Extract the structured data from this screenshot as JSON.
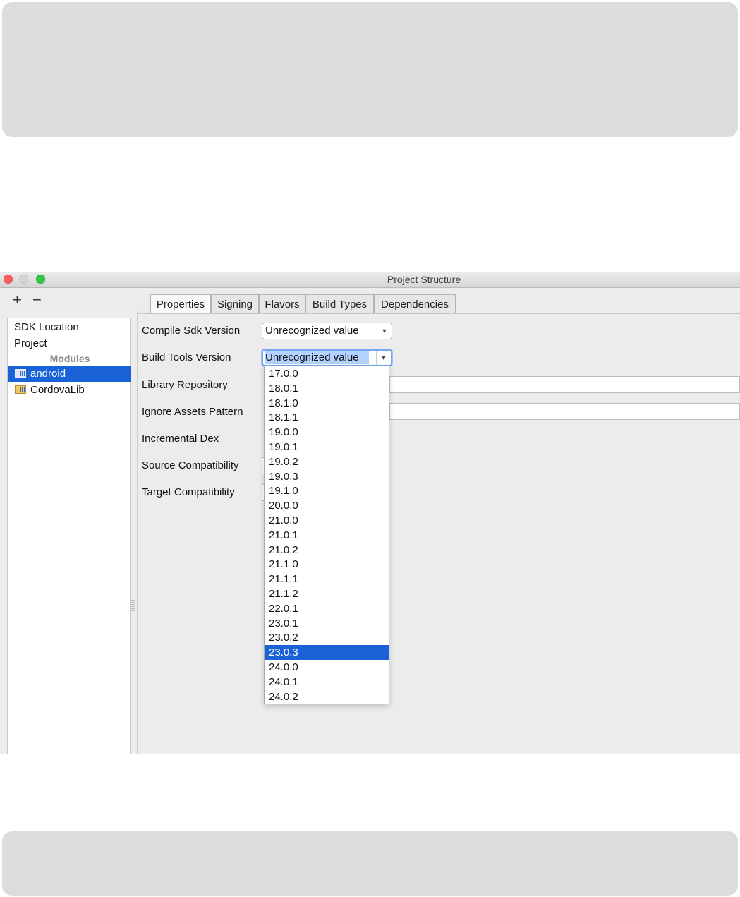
{
  "window": {
    "title": "Project Structure"
  },
  "toolbar": {
    "add_symbol": "+",
    "remove_symbol": "−"
  },
  "sidebar": {
    "sdk_location": "SDK Location",
    "project": "Project",
    "modules_header": "Modules",
    "modules": [
      {
        "label": "android",
        "selected": true
      },
      {
        "label": "CordovaLib",
        "selected": false
      }
    ]
  },
  "tabs": [
    {
      "label": "Properties",
      "active": true
    },
    {
      "label": "Signing"
    },
    {
      "label": "Flavors"
    },
    {
      "label": "Build Types"
    },
    {
      "label": "Dependencies"
    }
  ],
  "form": {
    "compile_sdk_label": "Compile Sdk Version",
    "compile_sdk_value": "Unrecognized value",
    "build_tools_label": "Build Tools Version",
    "build_tools_value": "Unrecognized value",
    "library_repo_label": "Library Repository",
    "ignore_assets_label": "Ignore Assets Pattern",
    "incremental_dex_label": "Incremental Dex",
    "source_compat_label": "Source Compatibility",
    "target_compat_label": "Target Compatibility"
  },
  "dropdown": {
    "selected": "23.0.3",
    "options": [
      "17.0.0",
      "18.0.1",
      "18.1.0",
      "18.1.1",
      "19.0.0",
      "19.0.1",
      "19.0.2",
      "19.0.3",
      "19.1.0",
      "20.0.0",
      "21.0.0",
      "21.0.1",
      "21.0.2",
      "21.1.0",
      "21.1.1",
      "21.1.2",
      "22.0.1",
      "23.0.1",
      "23.0.2",
      "23.0.3",
      "24.0.0",
      "24.0.1",
      "24.0.2"
    ]
  },
  "icons": {
    "combo_arrow": "▼",
    "module": "folder-module-icon"
  },
  "colors": {
    "selection": "#1a62d8",
    "close": "#fc605c",
    "maximize": "#34c84a"
  }
}
